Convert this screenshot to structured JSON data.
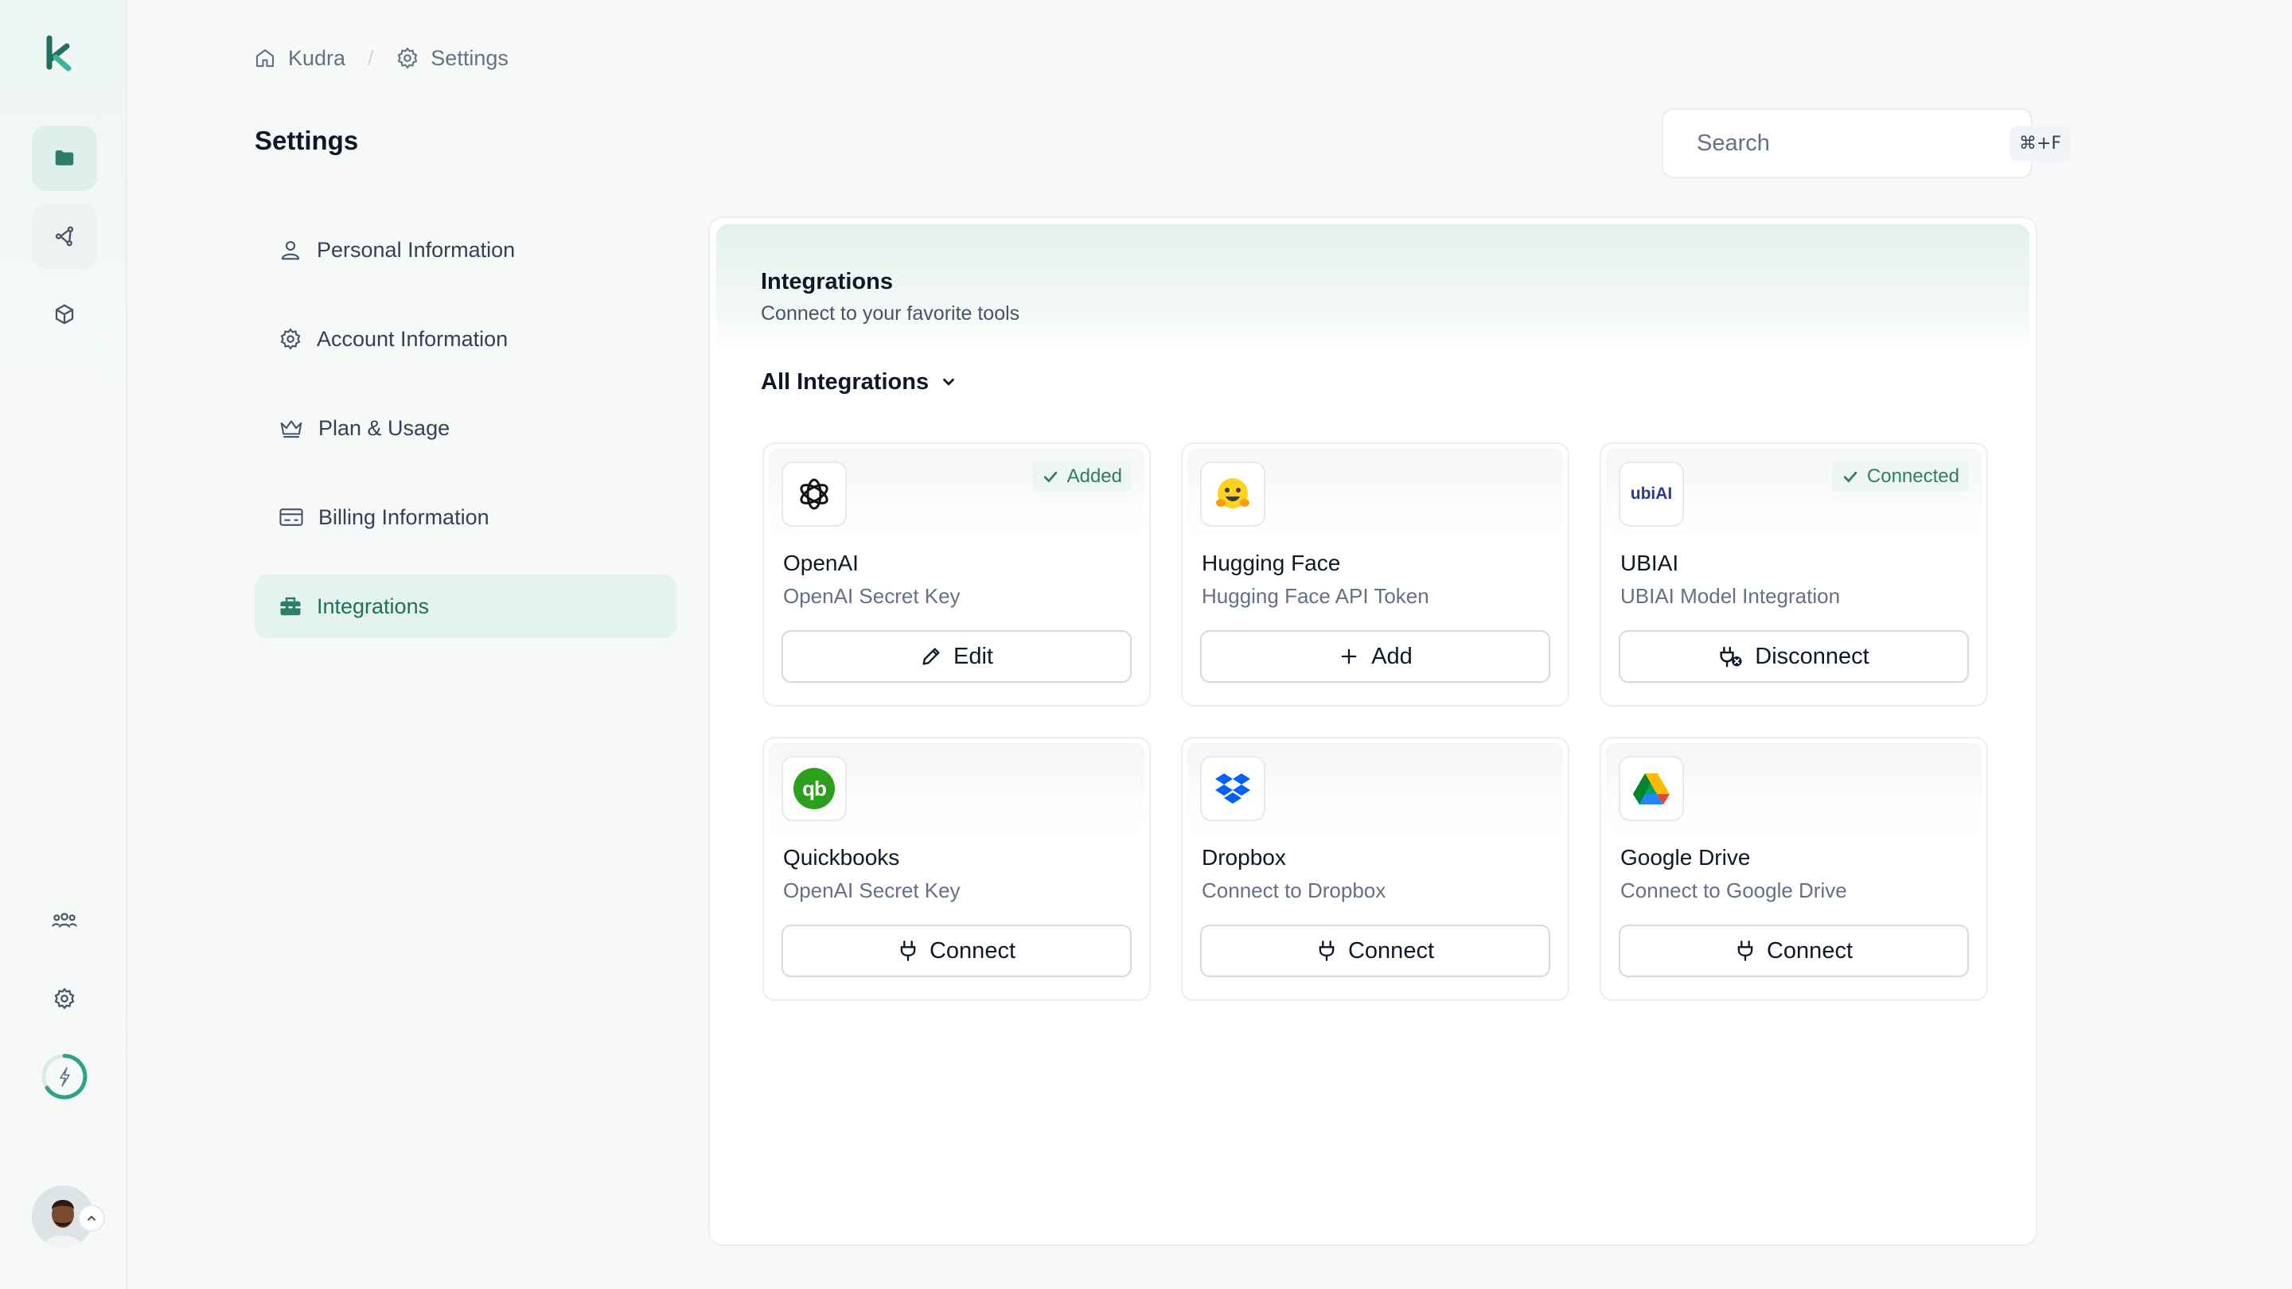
{
  "breadcrumb": [
    {
      "label": "Kudra",
      "icon": "home-icon"
    },
    {
      "label": "Settings",
      "icon": "gear-icon"
    }
  ],
  "page_title": "Settings",
  "search": {
    "placeholder": "Search",
    "shortcut": "⌘+F"
  },
  "settings_nav": [
    {
      "label": "Personal Information",
      "icon": "user-icon",
      "active": false
    },
    {
      "label": "Account Information",
      "icon": "gear-icon",
      "active": false
    },
    {
      "label": "Plan & Usage",
      "icon": "crown-icon",
      "active": false
    },
    {
      "label": "Billing Information",
      "icon": "billing-card-icon",
      "active": false
    },
    {
      "label": "Integrations",
      "icon": "toolbox-icon",
      "active": true
    }
  ],
  "panel": {
    "title": "Integrations",
    "subtitle": "Connect to your favorite tools",
    "filter_label": "All Integrations"
  },
  "integrations": [
    {
      "name": "OpenAI",
      "description": "OpenAI Secret Key",
      "badge": "Added",
      "action": "Edit",
      "action_icon": "pencil-icon",
      "logo": "openai-logo"
    },
    {
      "name": "Hugging Face",
      "description": "Hugging Face API Token",
      "badge": "",
      "action": "Add",
      "action_icon": "plus-icon",
      "logo": "hugging-face-logo"
    },
    {
      "name": "UBIAI",
      "description": "UBIAI Model Integration",
      "badge": "Connected",
      "action": "Disconnect",
      "action_icon": "plug-off-icon",
      "logo": "ubiai-logo",
      "logo_text": "ubiAI"
    },
    {
      "name": "Quickbooks",
      "description": "OpenAI Secret Key",
      "badge": "",
      "action": "Connect",
      "action_icon": "plug-icon",
      "logo": "quickbooks-logo",
      "logo_text": "qb"
    },
    {
      "name": "Dropbox",
      "description": "Connect to Dropbox",
      "badge": "",
      "action": "Connect",
      "action_icon": "plug-icon",
      "logo": "dropbox-logo"
    },
    {
      "name": "Google Drive",
      "description": "Connect to Google Drive",
      "badge": "",
      "action": "Connect",
      "action_icon": "plug-icon",
      "logo": "google-drive-logo"
    }
  ],
  "colors": {
    "accent": "#2d7d68",
    "active_bg": "#e5f3ef",
    "badge_bg": "#eef6f3",
    "quickbooks_green": "#2ca01c",
    "dropbox_blue": "#0061fe"
  }
}
